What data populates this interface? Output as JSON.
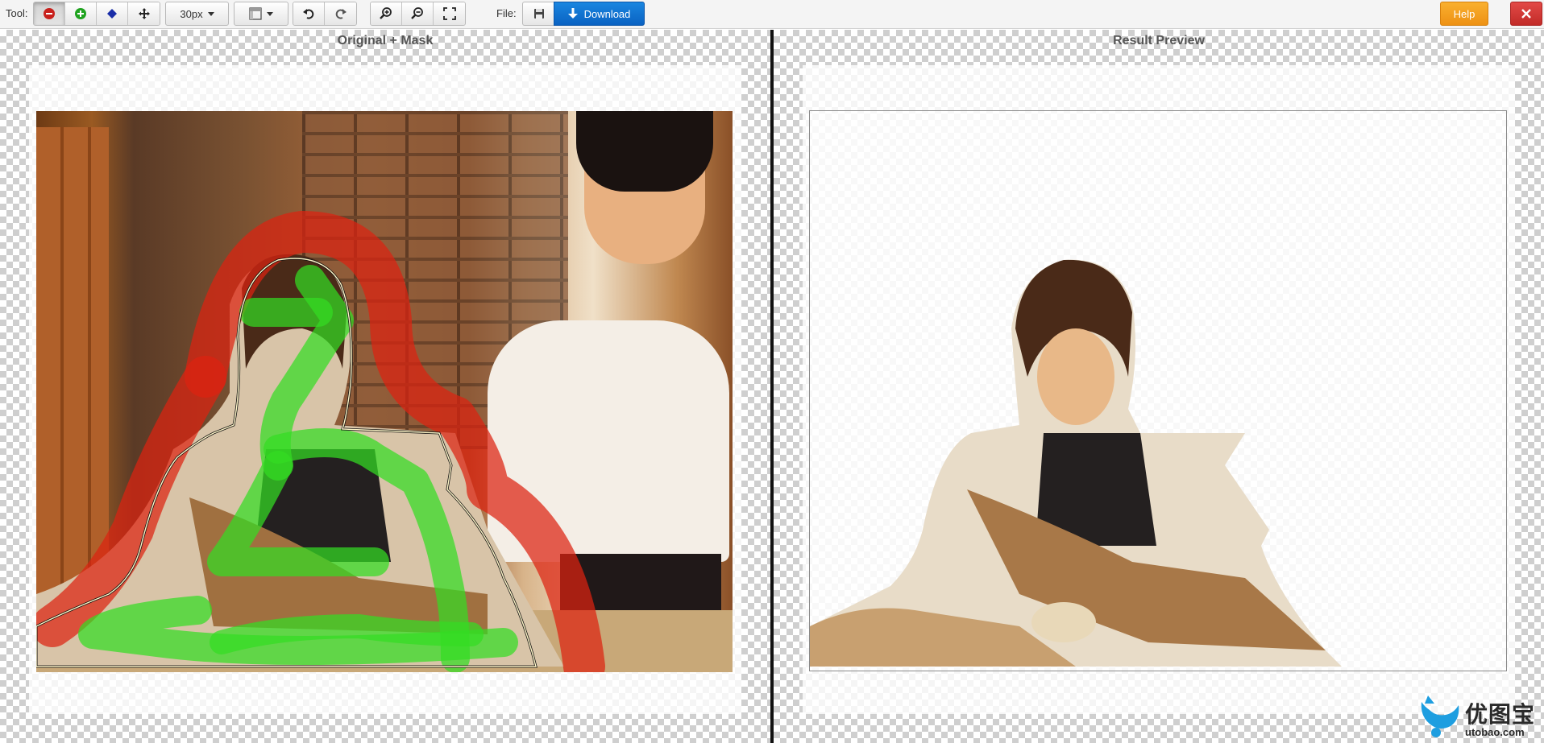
{
  "toolbar": {
    "tool_label": "Tool:",
    "brush_size": "30px",
    "file_label": "File:",
    "download_label": "Download",
    "help_label": "Help",
    "icons": {
      "remove": "minus-circle-icon",
      "add": "plus-circle-icon",
      "hair": "diamond-icon",
      "move": "move-icon",
      "view": "layout-icon",
      "undo": "undo-icon",
      "redo": "redo-icon",
      "zoom_in": "zoom-in-icon",
      "zoom_out": "zoom-out-icon",
      "fit": "fullscreen-icon",
      "save": "floppy-icon",
      "close": "close-icon"
    }
  },
  "panels": {
    "left_title": "Original + Mask",
    "right_title": "Result Preview"
  },
  "watermark": {
    "text": "优图宝",
    "sub": "utobao.com"
  },
  "colors": {
    "download": "#0a62c2",
    "help": "#ee9114",
    "close": "#c22b28",
    "keep_mask": "#33dd22",
    "remove_mask": "#dd2210"
  }
}
